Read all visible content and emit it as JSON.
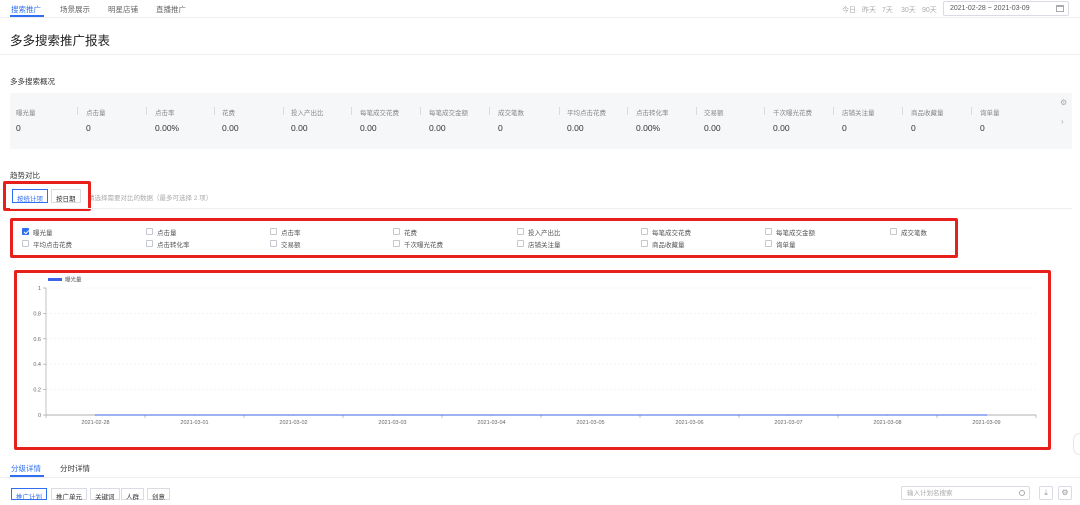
{
  "topnav": {
    "tabs": [
      "搜索推广",
      "场景展示",
      "明星店铺",
      "直播推广"
    ],
    "ranges": [
      "今日",
      "昨天",
      "7天",
      "30天",
      "90天"
    ],
    "date_range": "2021-02-28 ~ 2021-03-09"
  },
  "page_title": "多多搜索推广报表",
  "overview": {
    "title": "多多搜索概况",
    "metrics": [
      {
        "label": "曝光量",
        "value": "0"
      },
      {
        "label": "点击量",
        "value": "0"
      },
      {
        "label": "点击率",
        "value": "0.00%"
      },
      {
        "label": "花费",
        "value": "0.00"
      },
      {
        "label": "投入产出比",
        "value": "0.00"
      },
      {
        "label": "每笔成交花费",
        "value": "0.00"
      },
      {
        "label": "每笔成交金额",
        "value": "0.00"
      },
      {
        "label": "成交笔数",
        "value": "0"
      },
      {
        "label": "平均点击花费",
        "value": "0.00"
      },
      {
        "label": "点击转化率",
        "value": "0.00%"
      },
      {
        "label": "交易额",
        "value": "0.00"
      },
      {
        "label": "千次曝光花费",
        "value": "0.00"
      },
      {
        "label": "店铺关注量",
        "value": "0"
      },
      {
        "label": "商品收藏量",
        "value": "0"
      },
      {
        "label": "询单量",
        "value": "0"
      }
    ]
  },
  "trend": {
    "title": "趋势对比",
    "toggle": [
      "按统计项",
      "按日期"
    ],
    "hint": "请选择需要对比的数据（最多可选择 2 项）",
    "checkboxes": [
      {
        "label": "曝光量",
        "checked": true
      },
      {
        "label": "点击量",
        "checked": false
      },
      {
        "label": "点击率",
        "checked": false
      },
      {
        "label": "花费",
        "checked": false
      },
      {
        "label": "投入产出比",
        "checked": false
      },
      {
        "label": "每笔成交花费",
        "checked": false
      },
      {
        "label": "每笔成交金额",
        "checked": false
      },
      {
        "label": "成交笔数",
        "checked": false
      },
      {
        "label": "平均点击花费",
        "checked": false
      },
      {
        "label": "点击转化率",
        "checked": false
      },
      {
        "label": "交易额",
        "checked": false
      },
      {
        "label": "千次曝光花费",
        "checked": false
      },
      {
        "label": "店铺关注量",
        "checked": false
      },
      {
        "label": "商品收藏量",
        "checked": false
      },
      {
        "label": "询单量",
        "checked": false
      }
    ]
  },
  "chart_data": {
    "type": "line",
    "x": [
      "2021-02-28",
      "2021-03-01",
      "2021-03-02",
      "2021-03-03",
      "2021-03-04",
      "2021-03-05",
      "2021-03-06",
      "2021-03-07",
      "2021-03-08",
      "2021-03-09"
    ],
    "series": [
      {
        "name": "曝光量",
        "values": [
          0,
          0,
          0,
          0,
          0,
          0,
          0,
          0,
          0,
          0
        ]
      }
    ],
    "yticks": [
      "0",
      "0.2",
      "0.4",
      "0.6",
      "0.8",
      "1"
    ],
    "ylim": [
      0,
      1
    ],
    "grid": true,
    "legend": "top-left",
    "color": "#3d63e6"
  },
  "detail": {
    "tabs": [
      "分级详情",
      "分时详情"
    ],
    "buttons": [
      "推广计划",
      "推广单元",
      "关键词",
      "人群",
      "创意"
    ],
    "search_placeholder": "输入计划名搜索"
  },
  "colors": {
    "accent": "#2f6ff0",
    "highlight": "#e8201b",
    "series": "#3d63e6"
  }
}
